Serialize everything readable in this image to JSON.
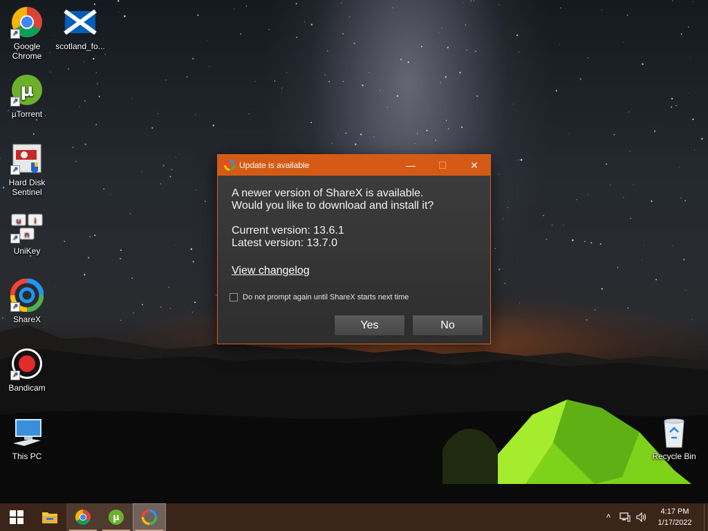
{
  "desktop": {
    "icons": [
      {
        "label": "Google\nChrome",
        "icon": "chrome-icon"
      },
      {
        "label": "scotland_fo...",
        "icon": "scotland-flag-icon"
      },
      {
        "label": "µTorrent",
        "icon": "utorrent-icon"
      },
      {
        "label": "Hard Disk\nSentinel",
        "icon": "hard-disk-sentinel-icon"
      },
      {
        "label": "UniKey",
        "icon": "unikey-icon"
      },
      {
        "label": "ShareX",
        "icon": "sharex-icon"
      },
      {
        "label": "Bandicam",
        "icon": "bandicam-icon"
      },
      {
        "label": "This PC",
        "icon": "this-pc-icon"
      },
      {
        "label": "Recycle Bin",
        "icon": "recycle-bin-icon"
      }
    ]
  },
  "dialog": {
    "title": "Update is available",
    "line1": "A newer version of ShareX is available.",
    "line2": "Would you like to download and install it?",
    "current_version": "Current version: 13.6.1",
    "latest_version": "Latest version: 13.7.0",
    "changelog_link": "View changelog",
    "checkbox_label": "Do not prompt again until ShareX starts next time",
    "checkbox_checked": false,
    "yes_label": "Yes",
    "no_label": "No",
    "minimize_glyph": "—",
    "maximize_glyph": "☐",
    "close_glyph": "✕"
  },
  "taskbar": {
    "items": [
      "start-icon",
      "file-explorer-icon",
      "chrome-icon",
      "utorrent-icon",
      "sharex-icon"
    ],
    "tray": {
      "chevron": "^",
      "time": "4:17 PM",
      "date": "1/17/2022"
    }
  },
  "colors": {
    "accent": "#d55a16",
    "dialog_bg": "#363636",
    "taskbar_bg": "#3b2418"
  }
}
